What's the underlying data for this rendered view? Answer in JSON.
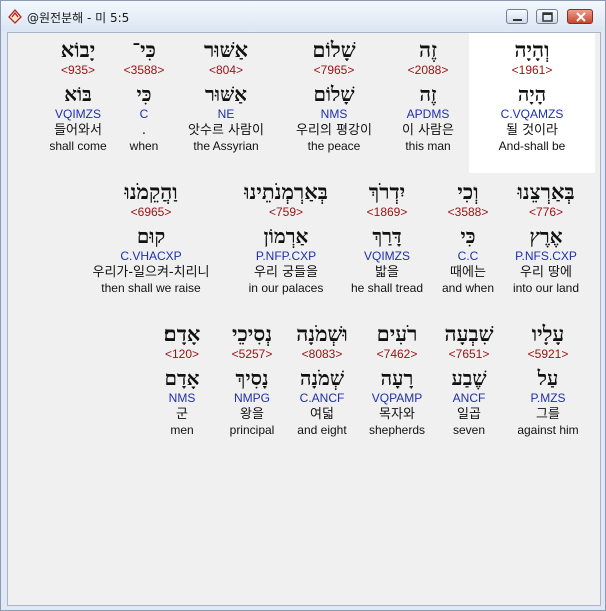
{
  "window": {
    "title": "@원전분해 - 미 5:5",
    "app_icon": "bible-app-icon",
    "controls": [
      "minimize-icon",
      "maximize-icon",
      "close-icon"
    ]
  },
  "rows": [
    [
      {
        "word": "יָבוֹא",
        "num": "<935>",
        "lemma": "בּוֹא",
        "morph": "VQIMZS",
        "ko": "들어와서",
        "en": "shall come"
      },
      {
        "word": "כִּי־",
        "num": "<3588>",
        "lemma": "כִּי",
        "morph": "C",
        "ko": ".",
        "en": "when"
      },
      {
        "word": "אַשּׁוּר",
        "num": "<804>",
        "lemma": "אַשּׁוּר",
        "morph": "NE",
        "ko": "앗수르 사람이",
        "en": "the Assyrian"
      },
      {
        "word": "שָׁלוֹם",
        "num": "<7965>",
        "lemma": "שָׁלוֹם",
        "morph": "NMS",
        "ko": "우리의 평강이",
        "en": "the peace"
      },
      {
        "word": "זֶה",
        "num": "<2088>",
        "lemma": "זֶה",
        "morph": "APDMS",
        "ko": "이 사람은",
        "en": "this man"
      },
      {
        "word": "וְהָיָה",
        "num": "<1961>",
        "lemma": "הָיָה",
        "morph": "C.VQAMZS",
        "ko": "될 것이라",
        "en": "And-shall be"
      }
    ],
    [
      {
        "word": "וַהֲקֵמֹנוּ",
        "num": "<6965>",
        "lemma": "קוּם",
        "morph": "C.VHACXP",
        "ko": "우리가-일으켜-치리니",
        "en": "then shall we raise"
      },
      {
        "word": "בְּאַרְמְנֹתֵינוּ",
        "num": "<759>",
        "lemma": "אַרְמוֹן",
        "morph": "P.NFP.CXP",
        "ko": "우리 궁들을",
        "en": "in our palaces"
      },
      {
        "word": "יִדְרֹךְ",
        "num": "<1869>",
        "lemma": "דָּרַךְ",
        "morph": "VQIMZS",
        "ko": "밟을",
        "en": "he shall tread"
      },
      {
        "word": "וְכִי",
        "num": "<3588>",
        "lemma": "כִּי",
        "morph": "C.C",
        "ko": "때에는",
        "en": "and when"
      },
      {
        "word": "בְּאַרְצֵנוּ",
        "num": "<776>",
        "lemma": "אֶרֶץ",
        "morph": "P.NFS.CXP",
        "ko": "우리 땅에",
        "en": "into our land"
      }
    ],
    [
      {
        "word": "אָדָם׃",
        "num": "<120>",
        "lemma": "אָדָם",
        "morph": "NMS",
        "ko": "군",
        "en": "men"
      },
      {
        "word": "נְסִיכֵי",
        "num": "<5257>",
        "lemma": "נָסִיךְ",
        "morph": "NMPG",
        "ko": "왕을",
        "en": "principal"
      },
      {
        "word": "וּשְׁמֹנָה",
        "num": "<8083>",
        "lemma": "שְׁמֹנָה",
        "morph": "C.ANCF",
        "ko": "여덟",
        "en": "and eight"
      },
      {
        "word": "רֹעִים",
        "num": "<7462>",
        "lemma": "רָעָה",
        "morph": "VQPAMP",
        "ko": "목자와",
        "en": "shepherds"
      },
      {
        "word": "שִׁבְעָה",
        "num": "<7651>",
        "lemma": "שֶׁבַע",
        "morph": "ANCF",
        "ko": "일곱",
        "en": "seven"
      },
      {
        "word": "עָלָיו",
        "num": "<5921>",
        "lemma": "עַל",
        "morph": "P.MZS",
        "ko": "그를",
        "en": "against him"
      }
    ]
  ]
}
